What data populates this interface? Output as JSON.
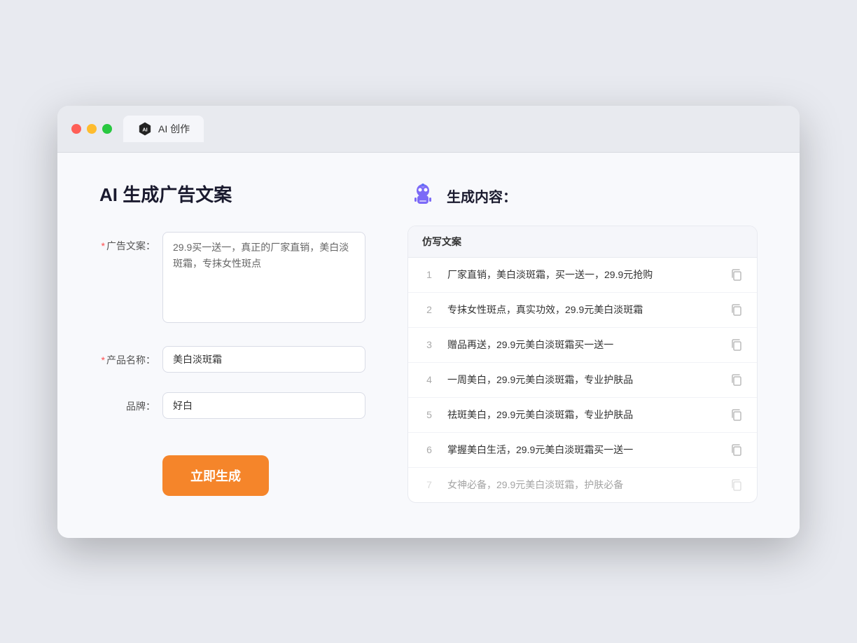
{
  "browser": {
    "tab_icon_label": "AI",
    "tab_label": "AI 创作"
  },
  "left_panel": {
    "page_title": "AI 生成广告文案",
    "ad_copy_label": "广告文案：",
    "ad_copy_required": "*",
    "ad_copy_value": "29.9买一送一，真正的厂家直销，美白淡斑霜，专抹女性斑点",
    "product_name_label": "产品名称：",
    "product_name_required": "*",
    "product_name_value": "美白淡斑霜",
    "brand_label": "品牌：",
    "brand_value": "好白",
    "generate_button": "立即生成"
  },
  "right_panel": {
    "title": "生成内容：",
    "column_header": "仿写文案",
    "results": [
      {
        "num": "1",
        "text": "厂家直销，美白淡斑霜，买一送一，29.9元抢购",
        "faded": false
      },
      {
        "num": "2",
        "text": "专抹女性斑点，真实功效，29.9元美白淡斑霜",
        "faded": false
      },
      {
        "num": "3",
        "text": "赠品再送，29.9元美白淡斑霜买一送一",
        "faded": false
      },
      {
        "num": "4",
        "text": "一周美白，29.9元美白淡斑霜，专业护肤品",
        "faded": false
      },
      {
        "num": "5",
        "text": "祛斑美白，29.9元美白淡斑霜，专业护肤品",
        "faded": false
      },
      {
        "num": "6",
        "text": "掌握美白生活，29.9元美白淡斑霜买一送一",
        "faded": false
      },
      {
        "num": "7",
        "text": "女神必备，29.9元美白淡斑霜，护肤必备",
        "faded": true
      }
    ]
  }
}
